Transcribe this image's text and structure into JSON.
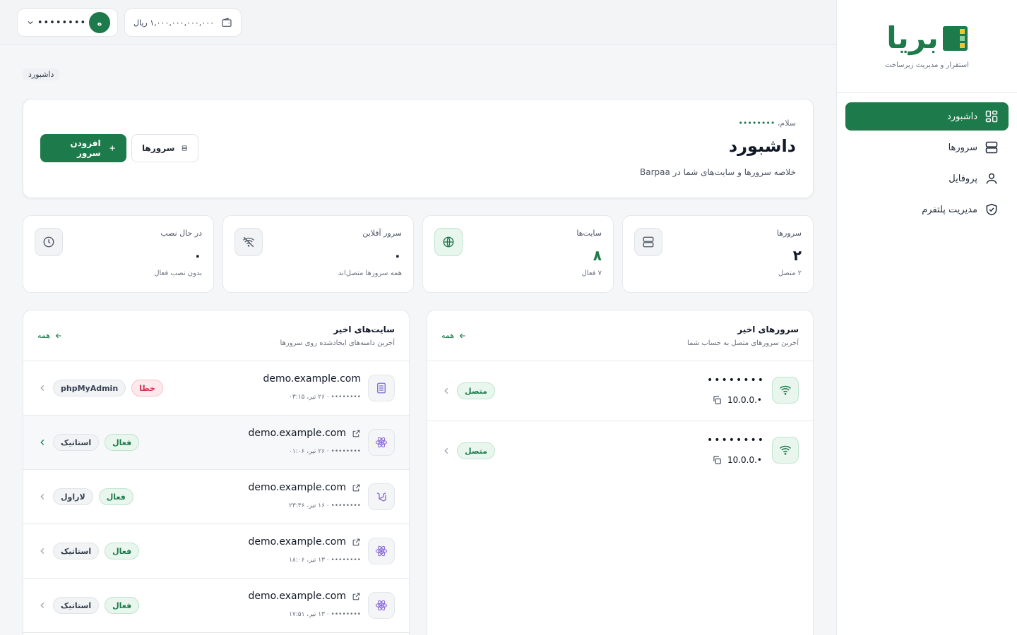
{
  "brand": {
    "logo_text": "بریا",
    "tagline": "استقرار و مدیریت زیرساخت"
  },
  "nav": [
    {
      "label": "داشبورد",
      "icon": "grid-icon",
      "active": true
    },
    {
      "label": "سرورها",
      "icon": "server-icon",
      "active": false
    },
    {
      "label": "پروفایل",
      "icon": "user-icon",
      "active": false
    },
    {
      "label": "مدیریت پلتفرم",
      "icon": "shield-check-icon",
      "active": false
    }
  ],
  "topbar": {
    "user": {
      "avatar": "ه",
      "name": "••••••••"
    },
    "wallet": {
      "balance": "۱,۰۰۰,۰۰۰,۰۰۰,۰۰۰ ریال"
    }
  },
  "breadcrumb": "داشبورد",
  "hero": {
    "greeting": "سلام،",
    "greeting_name": "••••••••",
    "title": "داشبورد",
    "description": "خلاصه سرورها و سایت‌های شما در Barpaa",
    "add_server_label": "افزودن سرور",
    "servers_label": "سرورها"
  },
  "stats": [
    {
      "label": "سرورها",
      "value": "۲",
      "sub": "۲ متصل",
      "icon": "server-icon"
    },
    {
      "label": "سایت‌ها",
      "value": "۸",
      "sub": "۷ فعال",
      "icon": "globe-icon"
    },
    {
      "label": "سرور آفلاین",
      "value": "۰",
      "sub": "همه سرورها متصل‌اند",
      "icon": "wifi-off-icon"
    },
    {
      "label": "در حال نصب",
      "value": "۰",
      "sub": "بدون نصب فعال",
      "icon": "clock-icon"
    }
  ],
  "recent_servers": {
    "title": "سرورهای اخیر",
    "subtitle": "آخرین سرورهای متصل به حساب شما",
    "all_label": "همه",
    "items": [
      {
        "name": "••••••••",
        "ip": "10.0.0.•",
        "status": "متصل"
      },
      {
        "name": "••••••••",
        "ip": "10.0.0.•",
        "status": "متصل"
      }
    ]
  },
  "recent_sites": {
    "title": "سایت‌های اخیر",
    "subtitle": "آخرین دامنه‌های ایجادشده روی سرورها",
    "all_label": "همه",
    "items": [
      {
        "domain": "demo.example.com",
        "meta": "•••••••• · ۲۶ تیر، ۰۳:۱۵",
        "type": "phpMyAdmin",
        "status": "خطا",
        "status_kind": "error",
        "icon": "database-icon",
        "external": false
      },
      {
        "domain": "demo.example.com",
        "meta": "•••••••• · ۲۶ تیر، ۰۱:۰۶",
        "type": "استاتیک",
        "status": "فعال",
        "status_kind": "ok",
        "icon": "react-icon",
        "external": true
      },
      {
        "domain": "demo.example.com",
        "meta": "•••••••• · ۱۶ تیر، ۲۳:۳۶",
        "type": "لاراول",
        "status": "فعال",
        "status_kind": "ok",
        "icon": "laravel-icon",
        "external": true
      },
      {
        "domain": "demo.example.com",
        "meta": "•••••••• · ۱۳ تیر، ۱۸:۰۶",
        "type": "استاتیک",
        "status": "فعال",
        "status_kind": "ok",
        "icon": "react-icon",
        "external": true
      },
      {
        "domain": "demo.example.com",
        "meta": "•••••••• · ۱۳ تیر، ۱۷:۵۱",
        "type": "استاتیک",
        "status": "فعال",
        "status_kind": "ok",
        "icon": "react-icon",
        "external": true
      }
    ]
  },
  "colors": {
    "primary": "#1d7a4a",
    "error": "#d23150",
    "background": "#f5f6f8"
  }
}
